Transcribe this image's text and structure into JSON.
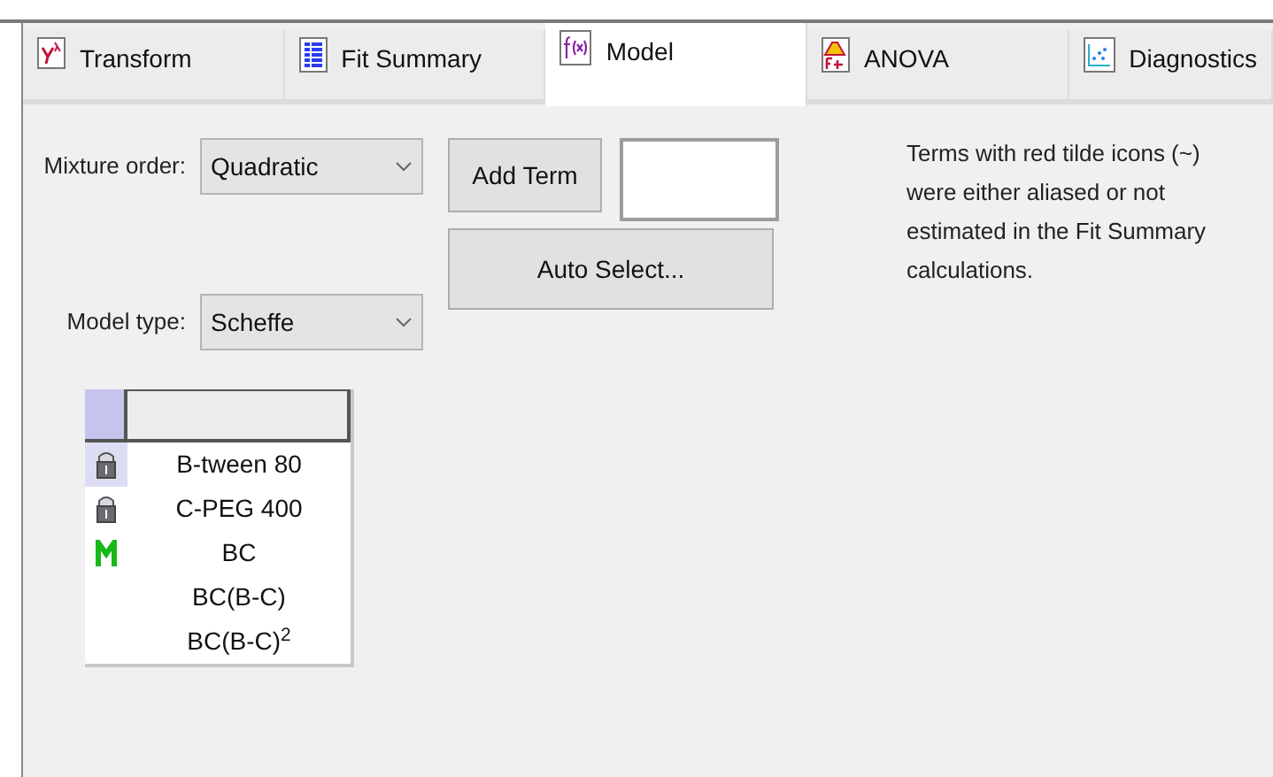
{
  "tabs": [
    {
      "label": "Transform",
      "kind": "transform",
      "selected": false
    },
    {
      "label": "Fit Summary",
      "kind": "summary",
      "selected": false
    },
    {
      "label": "Model",
      "kind": "model",
      "selected": true
    },
    {
      "label": "ANOVA",
      "kind": "anova",
      "selected": false
    },
    {
      "label": "Diagnostics",
      "kind": "diagnostics",
      "selected": false
    }
  ],
  "mixture_order": {
    "label": "Mixture order:",
    "value": "Quadratic"
  },
  "model_type": {
    "label": "Model type:",
    "value": "Scheffe"
  },
  "add_term_button": "Add Term",
  "auto_select_button": "Auto Select...",
  "note": "Terms with red tilde icons (~) were either aliased or not estimated in the Fit Summary calculations.",
  "terms": [
    {
      "label": "B-tween 80",
      "kind": "lock",
      "selected": true
    },
    {
      "label": "C-PEG 400",
      "kind": "lock",
      "selected": false
    },
    {
      "label": "BC",
      "kind": "model",
      "selected": false
    },
    {
      "label": "BC(B-C)",
      "kind": "none",
      "selected": false
    },
    {
      "label": "BC(B-C)$^{2}$",
      "kind": "none",
      "selected": false
    }
  ]
}
